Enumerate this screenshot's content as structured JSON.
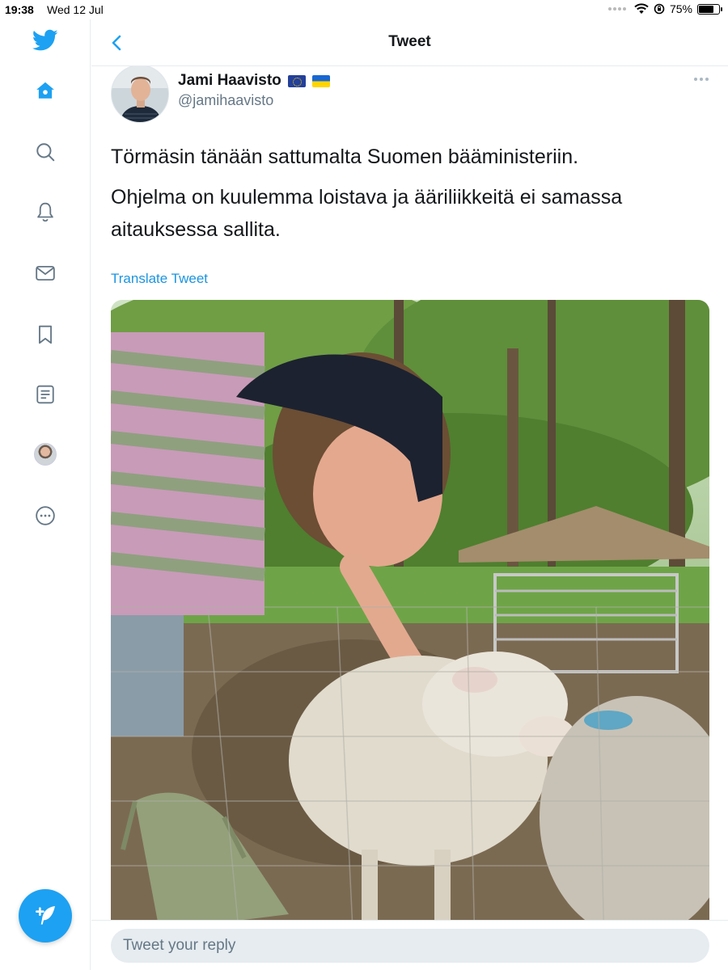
{
  "status_bar": {
    "time": "19:38",
    "date": "Wed 12 Jul",
    "battery": "75%",
    "battery_level": 0.75
  },
  "sidebar": {
    "items": [
      {
        "icon": "twitter-logo-icon"
      },
      {
        "icon": "home-icon"
      },
      {
        "icon": "search-icon"
      },
      {
        "icon": "bell-icon"
      },
      {
        "icon": "mail-icon"
      },
      {
        "icon": "bookmark-icon"
      },
      {
        "icon": "list-icon"
      },
      {
        "icon": "profile-avatar"
      },
      {
        "icon": "more-circle-icon"
      }
    ],
    "compose_icon": "compose-feather-icon"
  },
  "header": {
    "title": "Tweet",
    "back_icon": "chevron-left-icon"
  },
  "tweet": {
    "author": {
      "name": "Jami Haavisto",
      "handle": "@jamihaavisto"
    },
    "text": [
      "Törmäsin tänään sattumalta Suomen bääministeriin.",
      "Ohjelma on kuulemma loistava ja ääriliikkeitä ei samassa aitauksessa sallita."
    ],
    "translate_label": "Translate Tweet"
  },
  "reply": {
    "placeholder": "Tweet your reply"
  },
  "colors": {
    "accent": "#1da1f2",
    "link": "#1b95e0",
    "secondary_text": "#657786",
    "border": "#e6ecf0"
  }
}
